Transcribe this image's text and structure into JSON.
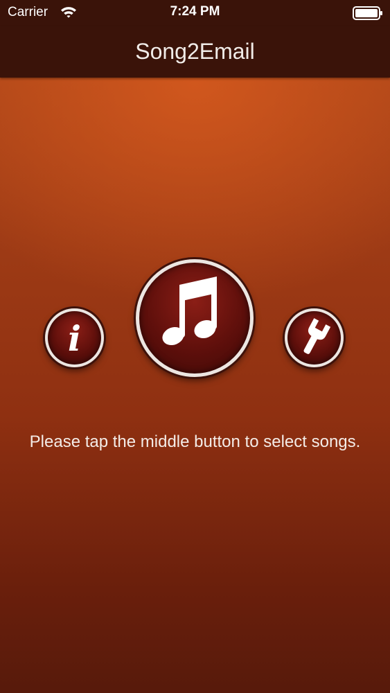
{
  "status_bar": {
    "carrier": "Carrier",
    "time": "7:24 PM"
  },
  "nav": {
    "title": "Song2Email"
  },
  "buttons": {
    "info_glyph": "i",
    "info_icon": "info-icon",
    "music_icon": "music-note-icon",
    "settings_icon": "wrench-icon"
  },
  "main": {
    "instruction": "Please tap the middle button to select songs."
  },
  "colors": {
    "bar_background": "#3a1309",
    "background_top": "#b24a1a",
    "background_bottom": "#571a0b",
    "button_fill": "#6e130e",
    "button_ring": "#ece6e2"
  }
}
